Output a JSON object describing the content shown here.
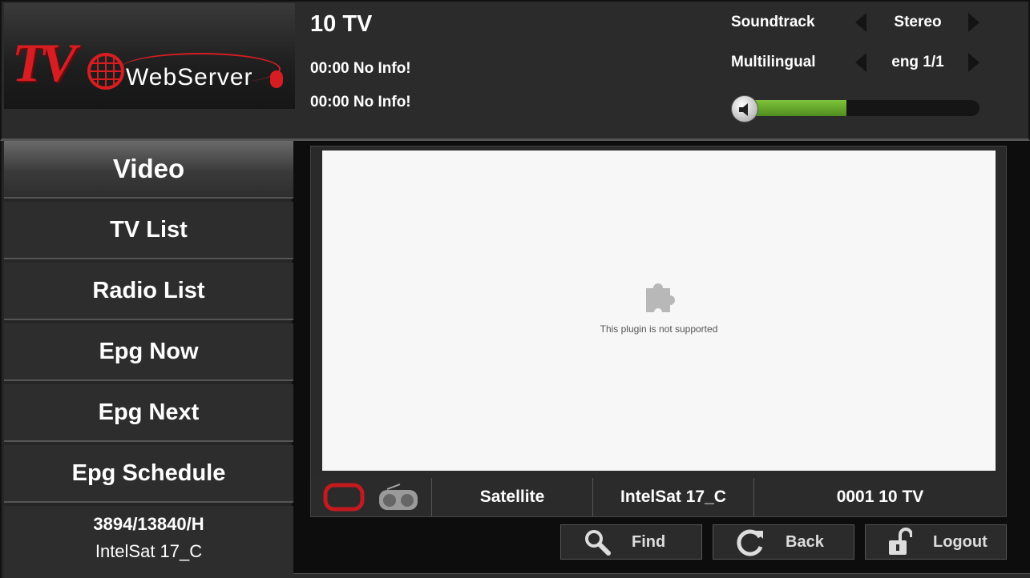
{
  "app": {
    "logo_tv": "TV",
    "logo_webserver": "WebServer"
  },
  "header": {
    "channel_title": "10 TV",
    "now_info": "00:00 No Info!",
    "next_info": "00:00 No Info!",
    "soundtrack_label": "Soundtrack",
    "soundtrack_value": "Stereo",
    "multilingual_label": "Multilingual",
    "multilingual_value": "eng 1/1",
    "volume_level": 0.44,
    "volume_color": "#7fc33b"
  },
  "sidebar": {
    "items": [
      {
        "label": "Video",
        "active": true
      },
      {
        "label": "TV List",
        "active": false
      },
      {
        "label": "Radio List",
        "active": false
      },
      {
        "label": "Epg Now",
        "active": false
      },
      {
        "label": "Epg Next",
        "active": false
      },
      {
        "label": "Epg Schedule",
        "active": false
      }
    ],
    "transponder": "3894/13840/H",
    "satellite": "IntelSat 17_C"
  },
  "player": {
    "plugin_message": "This plugin is not supported",
    "plugin_icon": "puzzle-piece-icon"
  },
  "info_bar": {
    "tv_icon": "tv-icon",
    "radio_icon": "radio-icon",
    "type": "Satellite",
    "satellite": "IntelSat 17_C",
    "channel": "0001 10 TV"
  },
  "actions": {
    "find_label": "Find",
    "back_label": "Back",
    "logout_label": "Logout"
  },
  "colors": {
    "brand_red": "#d61d22",
    "background": "#1c1c1c"
  }
}
